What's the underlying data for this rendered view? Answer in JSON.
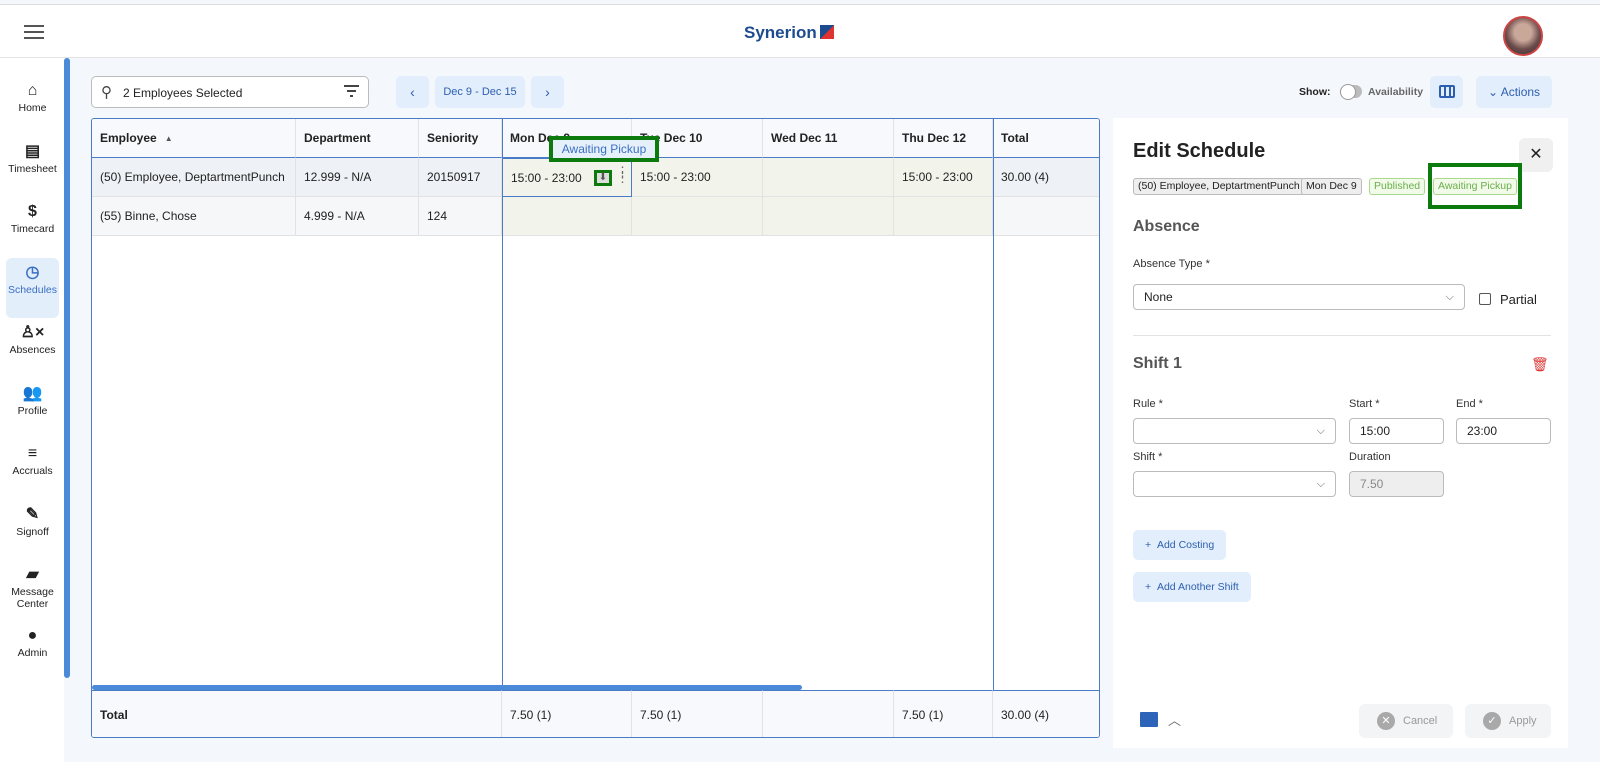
{
  "header": {
    "brand": "Synerion",
    "menu_icon": "hamburger-icon"
  },
  "sidebar": {
    "items": [
      {
        "label": "Home",
        "icon": "⌂"
      },
      {
        "label": "Timesheet",
        "icon": "▤"
      },
      {
        "label": "Timecard",
        "icon": "$"
      },
      {
        "label": "Schedules",
        "icon": "◷",
        "active": true
      },
      {
        "label": "Absences",
        "icon": "♙×"
      },
      {
        "label": "Profile",
        "icon": "👥"
      },
      {
        "label": "Accruals",
        "icon": "≡"
      },
      {
        "label": "Signoff",
        "icon": "✎"
      },
      {
        "label": "Message Center",
        "icon": "▰"
      },
      {
        "label": "Admin",
        "icon": "●"
      }
    ]
  },
  "toolbar": {
    "search_value": "2 Employees Selected",
    "prev": "‹",
    "date_range": "Dec 9 - Dec 15",
    "next": "›",
    "show_label": "Show:",
    "availability_label": "Availability",
    "availability_on": false,
    "actions_label": "Actions"
  },
  "grid": {
    "columns": [
      "Employee",
      "Department",
      "Seniority",
      "Mon Dec 9",
      "Tue Dec 10",
      "Wed Dec 11",
      "Thu Dec 12",
      "Total"
    ],
    "sort_indicator": "▲",
    "rows": [
      [
        "(50) Employee, DeptartmentPunch",
        "12.999 - N/A",
        "20150917",
        "15:00 - 23:00",
        "15:00 - 23:00",
        "",
        "15:00 - 23:00",
        "30.00 (4)"
      ],
      [
        "(55) Binne, Chose",
        "4.999 - N/A",
        "124",
        "",
        "",
        "",
        "",
        ""
      ]
    ],
    "footer": [
      "Total",
      "7.50 (1)",
      "7.50 (1)",
      "",
      "7.50 (1)",
      "30.00 (4)"
    ],
    "tooltip": "Awaiting Pickup"
  },
  "panel": {
    "title": "Edit Schedule",
    "chips": [
      "(50) Employee, DeptartmentPunch",
      "Mon Dec 9",
      "Published",
      "Awaiting Pickup"
    ],
    "absence_heading": "Absence",
    "absence_type_label": "Absence Type *",
    "absence_type_value": "None",
    "partial_label": "Partial",
    "shift_heading": "Shift 1",
    "rule_label": "Rule *",
    "start_label": "Start *",
    "end_label": "End *",
    "start_value": "15:00",
    "end_value": "23:00",
    "shift_label": "Shift *",
    "duration_label": "Duration",
    "duration_value": "7.50",
    "add_costing": "Add Costing",
    "add_shift": "Add Another Shift",
    "cancel": "Cancel",
    "apply": "Apply"
  },
  "colors": {
    "accent": "#2d5fb0",
    "highlight": "#0d7a0d",
    "published": "#6ab04a",
    "delete": "#d33"
  }
}
